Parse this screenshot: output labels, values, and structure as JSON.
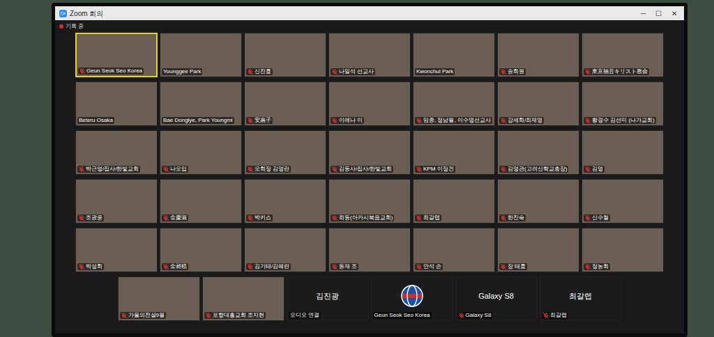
{
  "window": {
    "title": "Zoom 회의",
    "controls": [
      "─",
      "☐",
      "✕"
    ]
  },
  "recording": {
    "label": "기록 중"
  },
  "rows": [
    [
      {
        "label": "Geun Seok Seo Korea",
        "muted": true,
        "kind": "video",
        "speaking": true
      },
      {
        "label": "Younggee Park",
        "muted": false,
        "kind": "video",
        "speaking": false
      },
      {
        "label": "신진호",
        "muted": true,
        "kind": "video",
        "speaking": false
      },
      {
        "label": "나일석 선교사",
        "muted": true,
        "kind": "video",
        "speaking": false
      },
      {
        "label": "Kwonchul Park",
        "muted": false,
        "kind": "video",
        "speaking": false
      },
      {
        "label": "송희원",
        "muted": true,
        "kind": "video",
        "speaking": false
      },
      {
        "label": "東京福音キリスト教会",
        "muted": true,
        "kind": "video",
        "speaking": false
      }
    ],
    [
      {
        "label": "Beteru Osaka",
        "muted": false,
        "kind": "video",
        "speaking": false
      },
      {
        "label": "Bae Donglye, Park Youngmi",
        "muted": false,
        "kind": "video",
        "speaking": false
      },
      {
        "label": "安惠子",
        "muted": true,
        "kind": "video",
        "speaking": false
      },
      {
        "label": "이에나 이",
        "muted": true,
        "kind": "video",
        "speaking": false
      },
      {
        "label": "임종, 정남월, 이수영선교사",
        "muted": true,
        "kind": "video",
        "speaking": false
      },
      {
        "label": "강세희/최재영",
        "muted": true,
        "kind": "video",
        "speaking": false
      },
      {
        "label": "황경수 김선미 (나가교회)",
        "muted": true,
        "kind": "video",
        "speaking": false
      }
    ],
    [
      {
        "label": "박근영/집사/한빛교회",
        "muted": true,
        "kind": "video",
        "speaking": false
      },
      {
        "label": "나오입",
        "muted": true,
        "kind": "video",
        "speaking": false
      },
      {
        "label": "오희정 김영란",
        "muted": true,
        "kind": "video",
        "speaking": false
      },
      {
        "label": "김동사/집사/한빛교회",
        "muted": true,
        "kind": "video",
        "speaking": false
      },
      {
        "label": "KPM 이정건",
        "muted": true,
        "kind": "video",
        "speaking": false
      },
      {
        "label": "김영관(고려신학교총장)",
        "muted": true,
        "kind": "video",
        "speaking": false
      },
      {
        "label": "김영",
        "muted": true,
        "kind": "video",
        "speaking": false
      }
    ],
    [
      {
        "label": "조광웅",
        "muted": true,
        "kind": "video",
        "speaking": false
      },
      {
        "label": "金慶淑",
        "muted": true,
        "kind": "video",
        "speaking": false
      },
      {
        "label": "박키스",
        "muted": true,
        "kind": "video",
        "speaking": false
      },
      {
        "label": "최동(아카시복음교회)",
        "muted": true,
        "kind": "video",
        "speaking": false
      },
      {
        "label": "최갈렙",
        "muted": true,
        "kind": "video",
        "speaking": false
      },
      {
        "label": "한진숙",
        "muted": true,
        "kind": "video",
        "speaking": false
      },
      {
        "label": "신수철",
        "muted": true,
        "kind": "video",
        "speaking": false
      }
    ],
    [
      {
        "label": "박성희",
        "muted": true,
        "kind": "video",
        "speaking": false
      },
      {
        "label": "金昶植",
        "muted": true,
        "kind": "video",
        "speaking": false
      },
      {
        "label": "김기태/김혜란",
        "muted": true,
        "kind": "video",
        "speaking": false
      },
      {
        "label": "동재 조",
        "muted": true,
        "kind": "video",
        "speaking": false
      },
      {
        "label": "안석 손",
        "muted": true,
        "kind": "video",
        "speaking": false
      },
      {
        "label": "장 태호",
        "muted": true,
        "kind": "video",
        "speaking": false
      },
      {
        "label": "정농회",
        "muted": true,
        "kind": "video",
        "speaking": false
      }
    ],
    [
      {
        "label": "가을의전설9월",
        "muted": true,
        "kind": "video",
        "speaking": false
      },
      {
        "label": "포항대흥교회 조지현",
        "muted": true,
        "kind": "video",
        "speaking": false
      },
      {
        "label": "오디오 연결",
        "center": "김진광",
        "muted": false,
        "kind": "name-only",
        "speaking": false
      },
      {
        "label": "Geun Seok Seo Korea",
        "muted": false,
        "kind": "logo",
        "speaking": false
      },
      {
        "label": "Galaxy S8",
        "center": "Galaxy S8",
        "muted": true,
        "kind": "name-only",
        "speaking": false
      },
      {
        "label": "최갈렙",
        "center": "최갈렙",
        "muted": true,
        "kind": "name-only",
        "speaking": false
      }
    ]
  ]
}
